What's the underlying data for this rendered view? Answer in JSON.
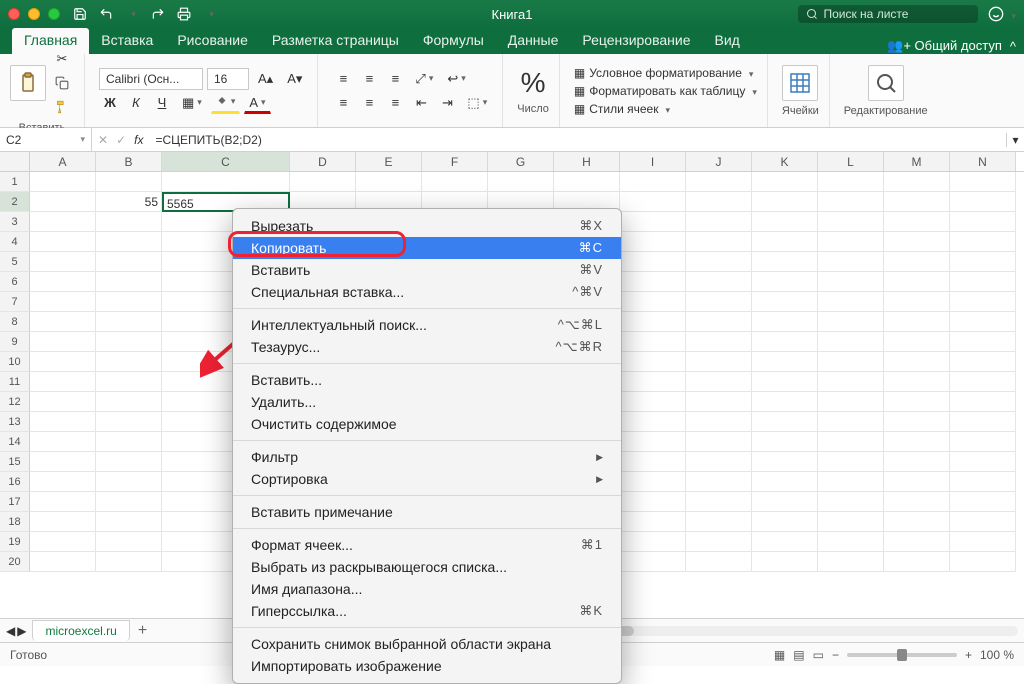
{
  "app": {
    "title": "Книга1",
    "search_placeholder": "Поиск на листе"
  },
  "tabs": {
    "home": "Главная",
    "insert": "Вставка",
    "draw": "Рисование",
    "layout": "Разметка страницы",
    "formulas": "Формулы",
    "data": "Данные",
    "review": "Рецензирование",
    "view": "Вид",
    "share": "Общий доступ"
  },
  "ribbon": {
    "paste": "Вставить",
    "font_name": "Calibri (Осн...",
    "font_size": "16",
    "number_group": "Число",
    "percent": "%",
    "cond_format": "Условное форматирование",
    "format_table": "Форматировать как таблицу",
    "cell_styles": "Стили ячеек",
    "cells": "Ячейки",
    "editing": "Редактирование",
    "bold": "Ж",
    "italic": "К",
    "underline": "Ч"
  },
  "formula_bar": {
    "name_box": "C2",
    "formula": "=СЦЕПИТЬ(B2;D2)"
  },
  "columns": [
    "A",
    "B",
    "C",
    "D",
    "E",
    "F",
    "G",
    "H",
    "I",
    "J",
    "K",
    "L",
    "M",
    "N"
  ],
  "cells": {
    "B2": "55",
    "C2": "5565"
  },
  "context_menu": {
    "cut": "Вырезать",
    "copy": "Копировать",
    "paste": "Вставить",
    "paste_special": "Специальная вставка...",
    "smart_lookup": "Интеллектуальный поиск...",
    "thesaurus": "Тезаурус...",
    "insert": "Вставить...",
    "delete": "Удалить...",
    "clear": "Очистить содержимое",
    "filter": "Фильтр",
    "sort": "Сортировка",
    "comment": "Вставить примечание",
    "format_cells": "Формат ячеек...",
    "dropdown": "Выбрать из раскрывающегося списка...",
    "define_name": "Имя диапазона...",
    "hyperlink": "Гиперссылка...",
    "screenshot": "Сохранить снимок выбранной области экрана",
    "import_image": "Импортировать изображение",
    "sc_cut": "⌘X",
    "sc_copy": "⌘C",
    "sc_paste": "⌘V",
    "sc_paste_special": "^⌘V",
    "sc_smart": "^⌥⌘L",
    "sc_thesaurus": "^⌥⌘R",
    "sc_format": "⌘1",
    "sc_hyperlink": "⌘K"
  },
  "sheet": {
    "tab1": "microexcel.ru"
  },
  "status": {
    "ready": "Готово",
    "zoom": "100 %"
  }
}
